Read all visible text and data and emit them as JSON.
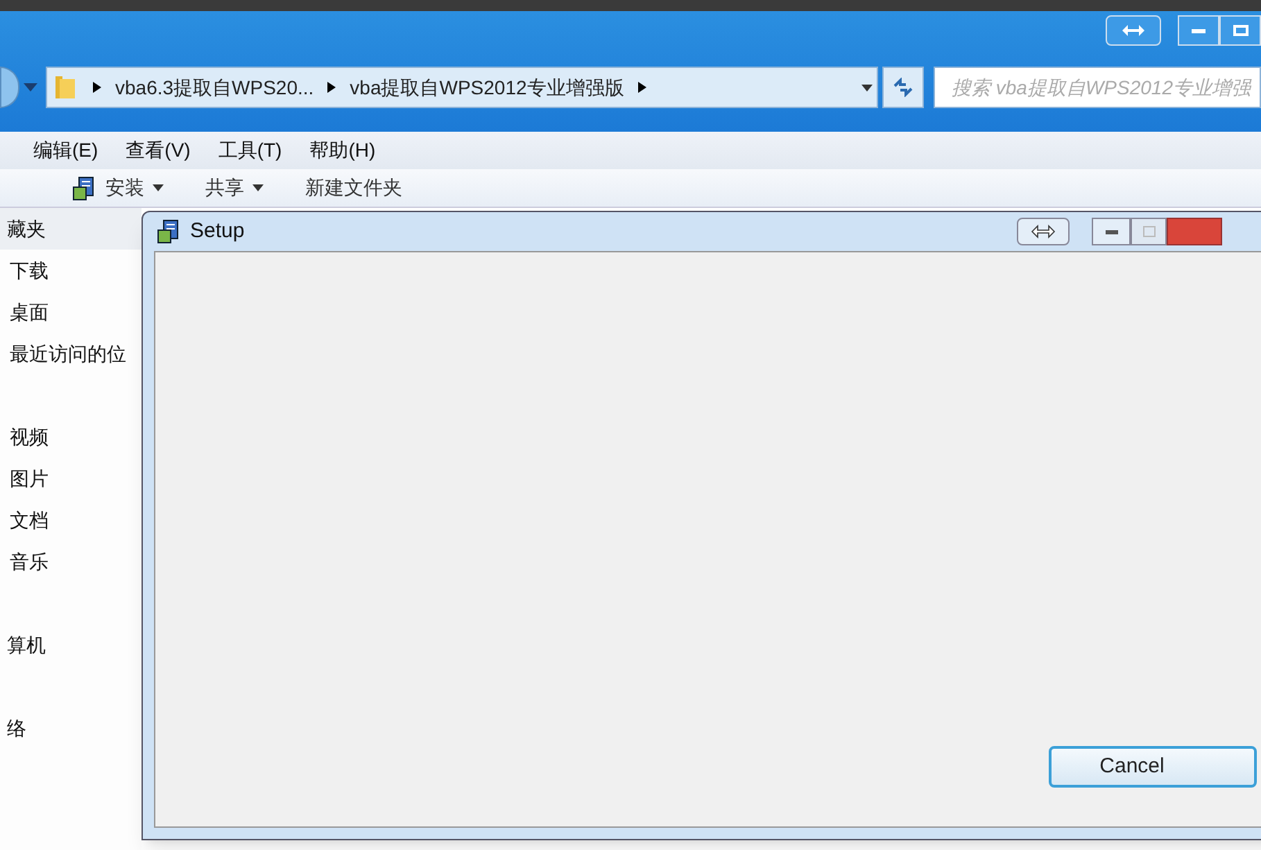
{
  "explorer": {
    "address": {
      "segments": [
        "vba6.3提取自WPS20...",
        "vba提取自WPS2012专业增强版"
      ]
    },
    "search": {
      "placeholder": "搜索 vba提取自WPS2012专业增强"
    },
    "menu": [
      "编辑(E)",
      "查看(V)",
      "工具(T)",
      "帮助(H)"
    ],
    "toolbar": [
      {
        "label": "安装",
        "dropdown": true
      },
      {
        "label": "共享",
        "dropdown": true
      },
      {
        "label": "新建文件夹",
        "dropdown": false
      }
    ],
    "sidebar": {
      "groups": [
        {
          "header": "藏夹",
          "items": [
            "下载",
            "桌面",
            "最近访问的位"
          ]
        },
        {
          "items": [
            "视频",
            "图片",
            "文档",
            "音乐"
          ]
        },
        {
          "header": "算机"
        },
        {
          "header": "络"
        }
      ]
    }
  },
  "dialog": {
    "title": "Setup",
    "buttons": [
      {
        "label": "Cancel"
      }
    ]
  }
}
